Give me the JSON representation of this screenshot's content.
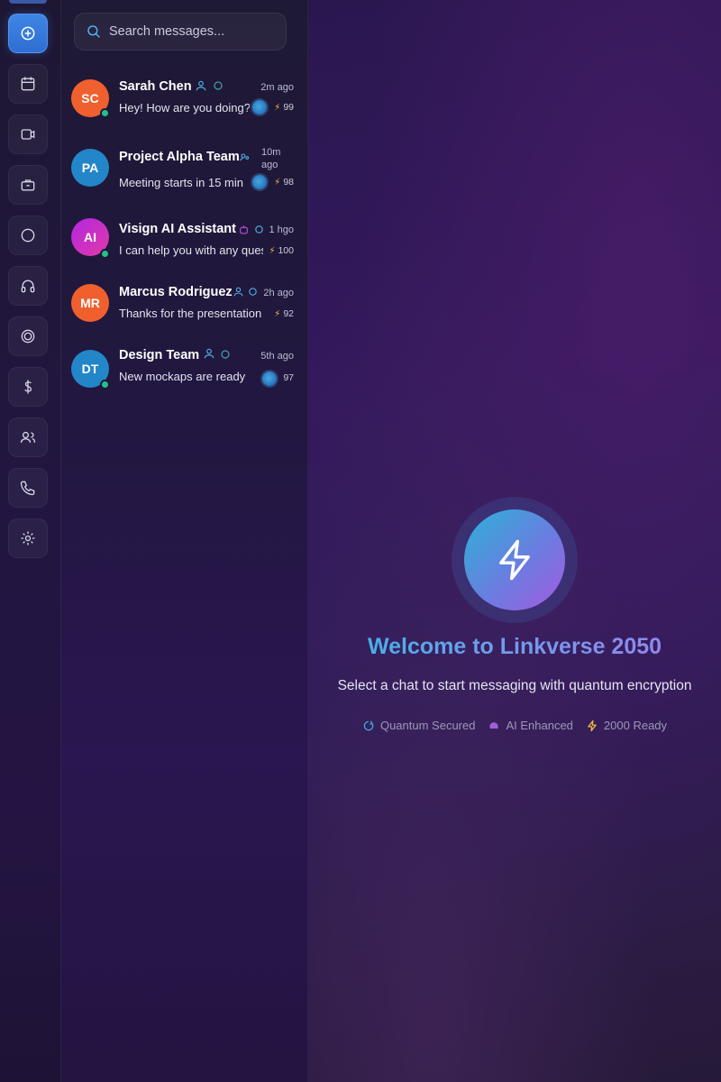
{
  "sidebar": {
    "items": [
      {
        "icon": "new-chat-icon",
        "active": true
      },
      {
        "icon": "calendar-icon",
        "active": false
      },
      {
        "icon": "video-icon",
        "active": false
      },
      {
        "icon": "briefcase-icon",
        "active": false
      },
      {
        "icon": "circle-icon",
        "active": false
      },
      {
        "icon": "headphones-icon",
        "active": false
      },
      {
        "icon": "target-icon",
        "active": false
      },
      {
        "icon": "dollar-icon",
        "active": false
      },
      {
        "icon": "users-icon",
        "active": false
      },
      {
        "icon": "phone-icon",
        "active": false
      },
      {
        "icon": "settings-icon",
        "active": false
      }
    ]
  },
  "search": {
    "placeholder": "Search messages..."
  },
  "chats": [
    {
      "initials": "SC",
      "name": "Sarah Chen",
      "preview": "Hey! How are you doing?",
      "time": "2m ago",
      "score": "99",
      "avatar_color": "#f0602e",
      "online": true
    },
    {
      "initials": "PA",
      "name": "Project Alpha Team",
      "preview": "Meeting starts in 15 min",
      "time": "10m ago",
      "score": "98",
      "avatar_color": "#2386c8",
      "online": false
    },
    {
      "initials": "AI",
      "name": "Visign AI Assistant",
      "preview": "I can help you with any quest",
      "time": "1 hgo",
      "score": "100",
      "avatar_color": "#d02ad0",
      "online": true
    },
    {
      "initials": "MR",
      "name": "Marcus Rodriguez",
      "preview": "Thanks for the presentation",
      "time": "2h ago",
      "score": "92",
      "avatar_color": "#f0602e",
      "online": false
    },
    {
      "initials": "DT",
      "name": "Design Team",
      "preview": "New mockaps are ready",
      "time": "5th ago",
      "score": "97",
      "avatar_color": "#2386c8",
      "online": true
    }
  ],
  "main": {
    "title": "Welcome to Linkverse 2050",
    "subtitle": "Select a chat to start messaging with quantum encryption",
    "features": [
      {
        "icon": "shield-icon",
        "label": "Quantum Secured",
        "color": "#3fa8d8"
      },
      {
        "icon": "robot-icon",
        "label": "AI Enhanced",
        "color": "#a05ed8"
      },
      {
        "icon": "lightning-icon",
        "label": "2000 Ready",
        "color": "#f0c040"
      }
    ]
  },
  "colors": {
    "accent_blue": "#3e86e4",
    "online_green": "#22c08b"
  }
}
